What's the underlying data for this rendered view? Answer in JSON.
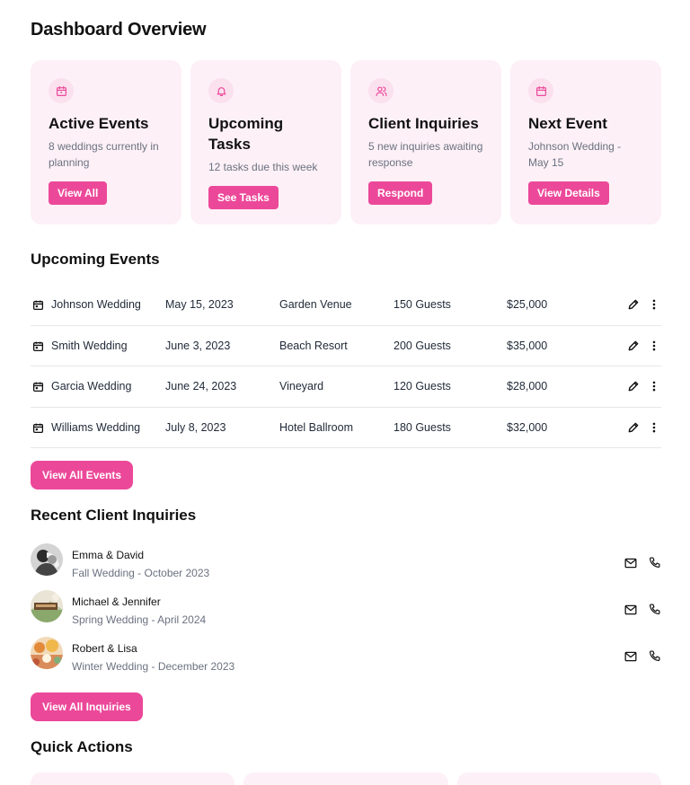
{
  "page": {
    "title": "Dashboard Overview"
  },
  "cards": [
    {
      "icon": "calendar-icon",
      "title": "Active Events",
      "desc": "8 weddings currently in planning",
      "button": "View All"
    },
    {
      "icon": "bell-icon",
      "title": "Upcoming Tasks",
      "desc": "12 tasks due this week",
      "button": "See Tasks"
    },
    {
      "icon": "users-icon",
      "title": "Client Inquiries",
      "desc": "5 new inquiries awaiting response",
      "button": "Respond"
    },
    {
      "icon": "calendar-icon",
      "title": "Next Event",
      "desc": "Johnson Wedding - May 15",
      "button": "View Details"
    }
  ],
  "events": {
    "title": "Upcoming Events",
    "rows": [
      {
        "name": "Johnson Wedding",
        "date": "May 15, 2023",
        "venue": "Garden Venue",
        "guests": "150 Guests",
        "price": "$25,000"
      },
      {
        "name": "Smith Wedding",
        "date": "June 3, 2023",
        "venue": "Beach Resort",
        "guests": "200 Guests",
        "price": "$35,000"
      },
      {
        "name": "Garcia Wedding",
        "date": "June 24, 2023",
        "venue": "Vineyard",
        "guests": "120 Guests",
        "price": "$28,000"
      },
      {
        "name": "Williams Wedding",
        "date": "July 8, 2023",
        "venue": "Hotel Ballroom",
        "guests": "180 Guests",
        "price": "$32,000"
      }
    ],
    "button": "View All Events"
  },
  "inquiries": {
    "title": "Recent Client Inquiries",
    "items": [
      {
        "name": "Emma & David",
        "detail": "Fall Wedding - October 2023"
      },
      {
        "name": "Michael & Jennifer",
        "detail": "Spring Wedding - April 2024"
      },
      {
        "name": "Robert & Lisa",
        "detail": "Winter Wedding - December 2023"
      }
    ],
    "button": "View All Inquiries"
  },
  "quick_actions": {
    "title": "Quick Actions"
  },
  "colors": {
    "accent": "#ec4899",
    "card_bg": "#fdf0f7",
    "icon_bg": "#fbe0ee"
  }
}
